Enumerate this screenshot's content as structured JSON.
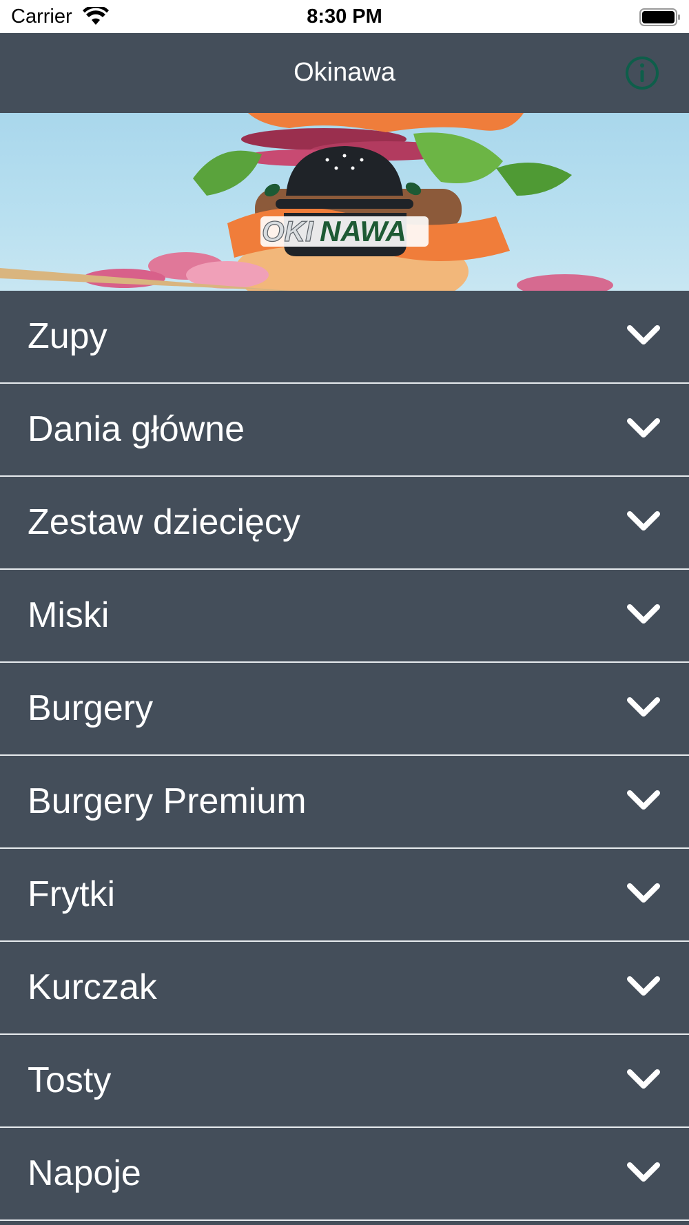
{
  "status_bar": {
    "carrier": "Carrier",
    "time": "8:30 PM"
  },
  "nav": {
    "title": "Okinawa",
    "info_icon": "info-circle-icon",
    "info_color": "#0e5e4a"
  },
  "hero": {
    "logo_text_left": "OKI",
    "logo_text_right": "NAWA",
    "logo_accent": "#1d5a34"
  },
  "menu": {
    "items": [
      {
        "label": "Zupy"
      },
      {
        "label": "Dania główne"
      },
      {
        "label": "Zestaw dziecięcy"
      },
      {
        "label": "Miski"
      },
      {
        "label": "Burgery"
      },
      {
        "label": "Burgery Premium"
      },
      {
        "label": "Frytki"
      },
      {
        "label": "Kurczak"
      },
      {
        "label": "Tosty"
      },
      {
        "label": "Napoje"
      }
    ],
    "chevron_icon": "chevron-down-icon"
  }
}
